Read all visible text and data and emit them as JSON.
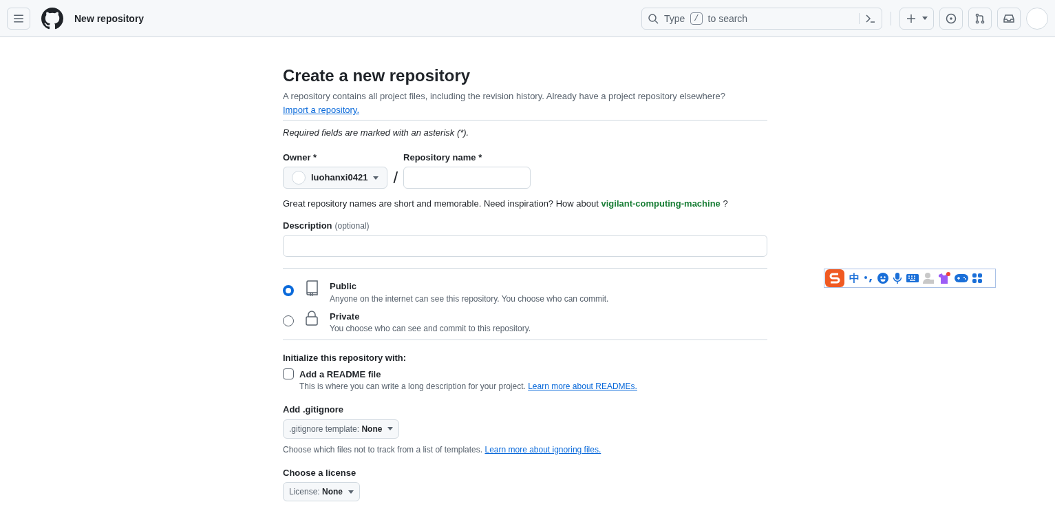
{
  "header": {
    "title": "New repository",
    "search": {
      "prefix": "Type",
      "key": "/",
      "suffix": "to search"
    }
  },
  "page": {
    "title": "Create a new repository",
    "intro": "A repository contains all project files, including the revision history. Already have a project repository elsewhere?",
    "import_link": "Import a repository.",
    "required_note": "Required fields are marked with an asterisk (*).",
    "owner": {
      "label": "Owner *",
      "value": "luohanxi0421"
    },
    "separator": "/",
    "repo_name": {
      "label": "Repository name *"
    },
    "suggestion": {
      "text": "Great repository names are short and memorable. Need inspiration? How about",
      "name": "vigilant-computing-machine",
      "end": "?"
    },
    "description": {
      "label": "Description",
      "hint": "(optional)"
    },
    "visibility": [
      {
        "kind": "book",
        "title": "Public",
        "text": "Anyone on the internet can see this repository. You choose who can commit.",
        "selected": true
      },
      {
        "kind": "lock",
        "title": "Private",
        "text": "You choose who can see and commit to this repository.",
        "selected": false
      }
    ],
    "initialize": {
      "heading": "Initialize this repository with:",
      "readme": {
        "label": "Add a README file",
        "checked": false,
        "text": "This is where you can write a long description for your project.",
        "link": "Learn more about READMEs."
      }
    },
    "gitignore": {
      "heading": "Add .gitignore",
      "button": ".gitignore template: **None**",
      "text": "Choose which files not to track from a list of templates.",
      "link": "Learn more about ignoring files."
    },
    "license": {
      "heading": "Choose a license",
      "button": "License: **None**"
    }
  },
  "ime_toolbar": {
    "mode": "中"
  }
}
